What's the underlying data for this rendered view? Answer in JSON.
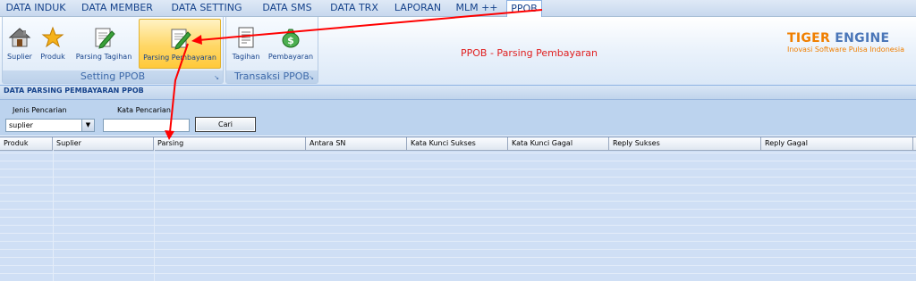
{
  "menu": {
    "tabs": [
      {
        "label": "DATA INDUK"
      },
      {
        "label": "DATA MEMBER"
      },
      {
        "label": "DATA SETTING"
      },
      {
        "label": "DATA SMS"
      },
      {
        "label": "DATA TRX"
      },
      {
        "label": "LAPORAN"
      },
      {
        "label": "MLM ++"
      },
      {
        "label": "PPOB",
        "active": true
      }
    ]
  },
  "ribbon": {
    "groups": [
      {
        "label": "Setting PPOB",
        "buttons": [
          {
            "label": "Suplier",
            "icon": "house-icon"
          },
          {
            "label": "Produk",
            "icon": "star-icon"
          },
          {
            "label": "Parsing Tagihan",
            "icon": "pencil-document-icon"
          },
          {
            "label": "Parsing Pembayaran",
            "icon": "pencil-document-icon",
            "active": true
          }
        ]
      },
      {
        "label": "Transaksi PPOB",
        "buttons": [
          {
            "label": "Tagihan",
            "icon": "document-icon"
          },
          {
            "label": "Pembayaran",
            "icon": "money-bag-icon"
          }
        ]
      }
    ],
    "title": "PPOB - Parsing Pembayaran"
  },
  "brand": {
    "name_a": "TIGER",
    "name_b": "ENGINE",
    "tagline": "Inovasi Software Pulsa Indonesia"
  },
  "section": {
    "title": "DATA PARSING PEMBAYARAN PPOB"
  },
  "filter": {
    "jenis_label": "Jenis Pencarian",
    "jenis_value": "suplier",
    "kata_label": "Kata Pencarian",
    "kata_value": "",
    "search_button": "Cari"
  },
  "table": {
    "columns": [
      "Produk",
      "Suplier",
      "Parsing",
      "Antara SN",
      "Kata Kunci Sukses",
      "Kata Kunci Gagal",
      "Reply Sukses",
      "Reply Gagal"
    ],
    "rows": []
  },
  "colors": {
    "accent": "#15428b",
    "title_red": "#e02020",
    "brand_orange": "#f07f00",
    "annotation_arrow": "#ff0000",
    "active_button": "#ffd766"
  }
}
